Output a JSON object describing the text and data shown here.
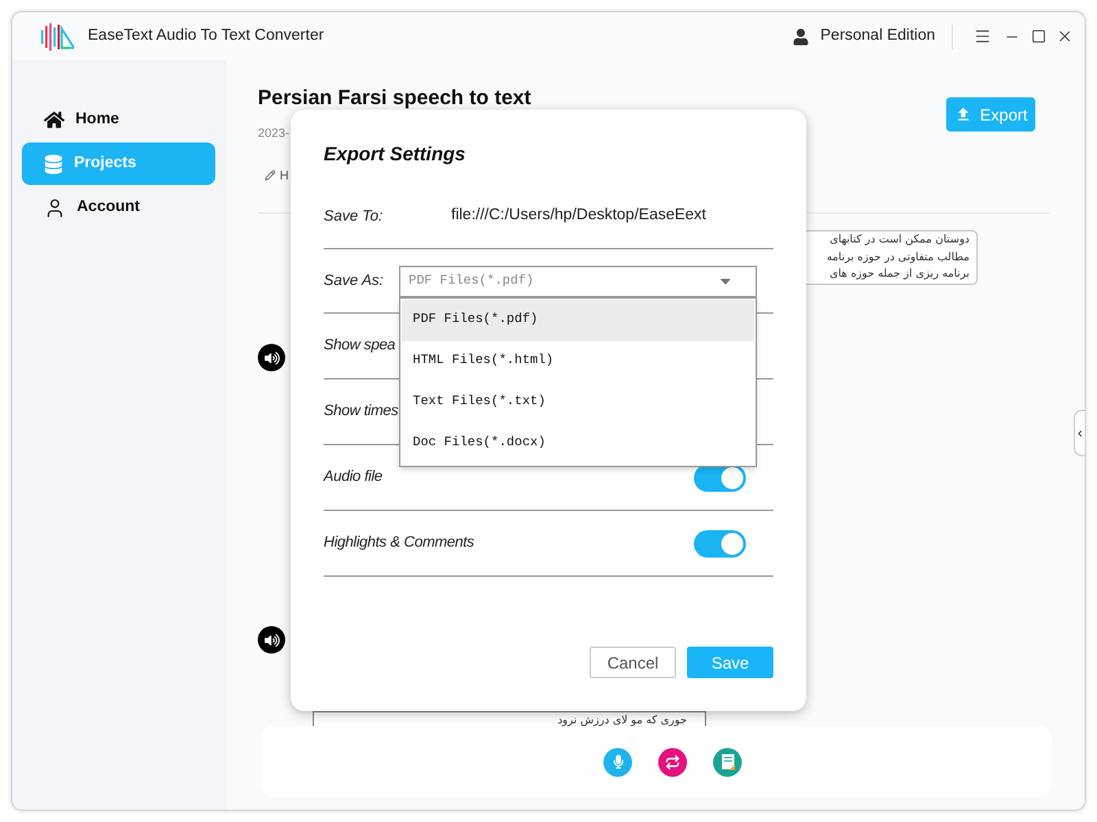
{
  "title_bar": {
    "app_name": "EaseText Audio To Text Converter",
    "edition": "Personal Edition"
  },
  "sidebar": {
    "items": [
      {
        "label": "Home",
        "kind": "home",
        "selected": false
      },
      {
        "label": "Projects",
        "kind": "projects",
        "selected": true
      },
      {
        "label": "Account",
        "kind": "account",
        "selected": false
      }
    ]
  },
  "project": {
    "title": "Persian Farsi speech to text",
    "date": "2023-",
    "tab_label": "H",
    "export_button": "Export"
  },
  "transcript": {
    "top_snippet": [
      "دوستان ممکن است در کتابهای",
      "مطالب متفاوتی در حوزه برنامه",
      "برنامه ریزی از جمله حوزه های"
    ],
    "bottom_snippet": "جوری که مو لای درزش نرود"
  },
  "dialog": {
    "title": "Export Settings",
    "save_to": {
      "label": "Save To:",
      "value": "file:///C:/Users/hp/Desktop/EaseEext"
    },
    "save_as": {
      "label": "Save As:",
      "value": "PDF Files(*.pdf)",
      "expanded": true,
      "options": [
        {
          "label": "PDF Files(*.pdf)",
          "selected": true
        },
        {
          "label": "HTML Files(*.html)",
          "selected": false
        },
        {
          "label": "Text Files(*.txt)",
          "selected": false
        },
        {
          "label": "Doc Files(*.docx)",
          "selected": false
        }
      ]
    },
    "rows": [
      {
        "kind": "covered",
        "label": "Show spea"
      },
      {
        "kind": "covered",
        "label": "Show times"
      },
      {
        "kind": "switch",
        "label": "Audio file",
        "on": true
      },
      {
        "kind": "switch",
        "label": "Highlights & Comments",
        "on": true
      }
    ],
    "buttons": [
      {
        "kind": "secondary",
        "label": "Cancel"
      },
      {
        "kind": "primary",
        "label": "Save"
      }
    ]
  }
}
